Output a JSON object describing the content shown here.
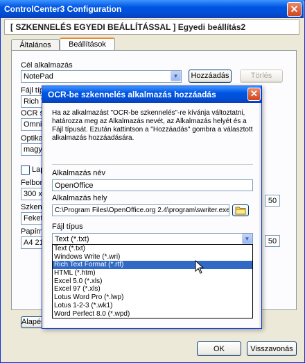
{
  "window": {
    "title": "ControlCenter3 Configuration",
    "close_symbol": "✕",
    "header": "[ SZKENNELÉS EGYEDI BEÁLLÍTÁSSAL ]   Egyedi beállítás2"
  },
  "tabs": [
    {
      "label": "Általános"
    },
    {
      "label": "Beállítások"
    }
  ],
  "panel": {
    "target_app_label": "Cél alkalmazás",
    "target_app_value": "NotePad",
    "add_button": "Hozzáadás",
    "delete_button": "Törlés",
    "file_type_label": "Fájl típus",
    "file_type_value": "Rich T",
    "ocr_label": "OCR sz",
    "ocr_value": "OmniP",
    "ocr_lang_label": "Optikai",
    "ocr_lang_value": "magyar",
    "checkbox_label": "Lapo",
    "resolution_label": "Felbont",
    "resolution_value": "300 x 3",
    "brightness_value": "50",
    "scan_type_label": "Szkenn",
    "scan_type_value": "Fekete",
    "paper_label": "Papírme",
    "paper_value": "A4 210",
    "contrast_value": "50",
    "restore_button": "Alapértelmezések visszaállítása"
  },
  "footer": {
    "ok_button": "OK",
    "cancel_button": "Visszavonás"
  },
  "dialog": {
    "title": "OCR-be szkennelés alkalmazás hozzáadás",
    "close_symbol": "✕",
    "description": "Ha az alkalmazást \"OCR-be szkennelés\"-re kívánja változtatni, határozza meg az Alkalmazás nevét, az Alkalmazás helyét és a Fájl típusát. Ezután kattintson a \"Hozzáadás\" gombra a választott alkalmazás hozzáadására.",
    "app_name_label": "Alkalmazás név",
    "app_name_value": "OpenOffice",
    "app_path_label": "Alkalmazás hely",
    "app_path_value": "C:\\Program Files\\OpenOffice.org 2.4\\program\\swriter.exe",
    "file_type_label": "Fájl típus",
    "file_type_value": "Text (*.txt)",
    "file_type_options": [
      "Text (*.txt)",
      "Windows Write (*.wri)",
      "Rich Text Format (*.rtf)",
      "HTML (*.htm)",
      "Excel 5.0 (*.xls)",
      "Excel 97 (*.xls)",
      "Lotus Word Pro (*.lwp)",
      "Lotus 1-2-3 (*.wk1)",
      "Word Perfect 8.0 (*.wpd)"
    ],
    "selected_option_index": 2
  },
  "colors": {
    "title_blue": "#0054e3",
    "selection_blue": "#316ac5",
    "tab_accent": "#e68b2c"
  }
}
